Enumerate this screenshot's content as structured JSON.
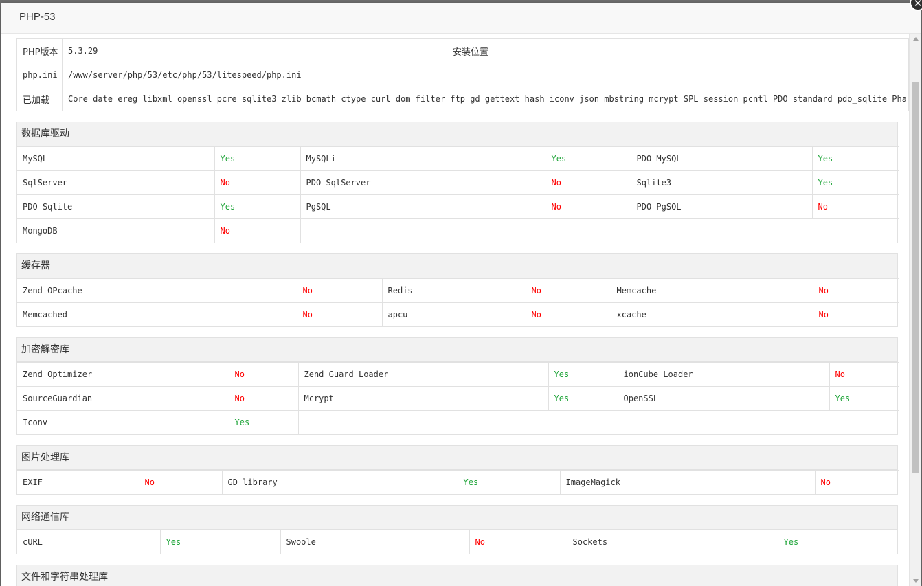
{
  "window": {
    "title": "PHP-53",
    "close_glyph": "✕"
  },
  "info": {
    "rows": [
      {
        "label": "PHP版本",
        "value": "5.3.29",
        "extra_label": "安装位置",
        "extra_value": ""
      },
      {
        "label": "php.ini",
        "value": "/www/server/php/53/etc/php/53/litespeed/php.ini"
      },
      {
        "label": "已加载",
        "value": "Core date ereg libxml openssl pcre sqlite3 zlib bcmath ctype curl dom filter ftp gd gettext hash iconv json mbstring mcrypt SPL session pcntl PDO standard pdo_sqlite Phar"
      }
    ]
  },
  "sections": [
    {
      "title": "数据库驱动",
      "rows": [
        [
          {
            "name": "MySQL",
            "status": "Yes"
          },
          {
            "name": "MySQLi",
            "status": "Yes"
          },
          {
            "name": "PDO-MySQL",
            "status": "Yes"
          }
        ],
        [
          {
            "name": "SqlServer",
            "status": "No"
          },
          {
            "name": "PDO-SqlServer",
            "status": "No"
          },
          {
            "name": "Sqlite3",
            "status": "Yes"
          }
        ],
        [
          {
            "name": "PDO-Sqlite",
            "status": "Yes"
          },
          {
            "name": "PgSQL",
            "status": "No"
          },
          {
            "name": "PDO-PgSQL",
            "status": "No"
          }
        ],
        [
          {
            "name": "MongoDB",
            "status": "No"
          }
        ]
      ]
    },
    {
      "title": "缓存器",
      "rows": [
        [
          {
            "name": "Zend OPcache",
            "status": "No"
          },
          {
            "name": "Redis",
            "status": "No"
          },
          {
            "name": "Memcache",
            "status": "No"
          }
        ],
        [
          {
            "name": "Memcached",
            "status": "No"
          },
          {
            "name": "apcu",
            "status": "No"
          },
          {
            "name": "xcache",
            "status": "No"
          }
        ]
      ]
    },
    {
      "title": "加密解密库",
      "rows": [
        [
          {
            "name": "Zend Optimizer",
            "status": "No"
          },
          {
            "name": "Zend Guard Loader",
            "status": "Yes"
          },
          {
            "name": "ionCube Loader",
            "status": "No"
          }
        ],
        [
          {
            "name": "SourceGuardian",
            "status": "No"
          },
          {
            "name": "Mcrypt",
            "status": "Yes"
          },
          {
            "name": "OpenSSL",
            "status": "Yes"
          }
        ],
        [
          {
            "name": "Iconv",
            "status": "Yes"
          }
        ]
      ]
    },
    {
      "title": "图片处理库",
      "rows": [
        [
          {
            "name": "EXIF",
            "status": "No"
          },
          {
            "name": "GD library",
            "status": "Yes"
          },
          {
            "name": "ImageMagick",
            "status": "No"
          }
        ]
      ]
    },
    {
      "title": "网络通信库",
      "rows": [
        [
          {
            "name": "cURL",
            "status": "Yes"
          },
          {
            "name": "Swoole",
            "status": "No"
          },
          {
            "name": "Sockets",
            "status": "Yes"
          }
        ]
      ]
    },
    {
      "title": "文件和字符串处理库",
      "rows": []
    }
  ],
  "colors": {
    "yes": "#20a53a",
    "no": "#ff0000",
    "header_bg": "#f2f2f2"
  }
}
